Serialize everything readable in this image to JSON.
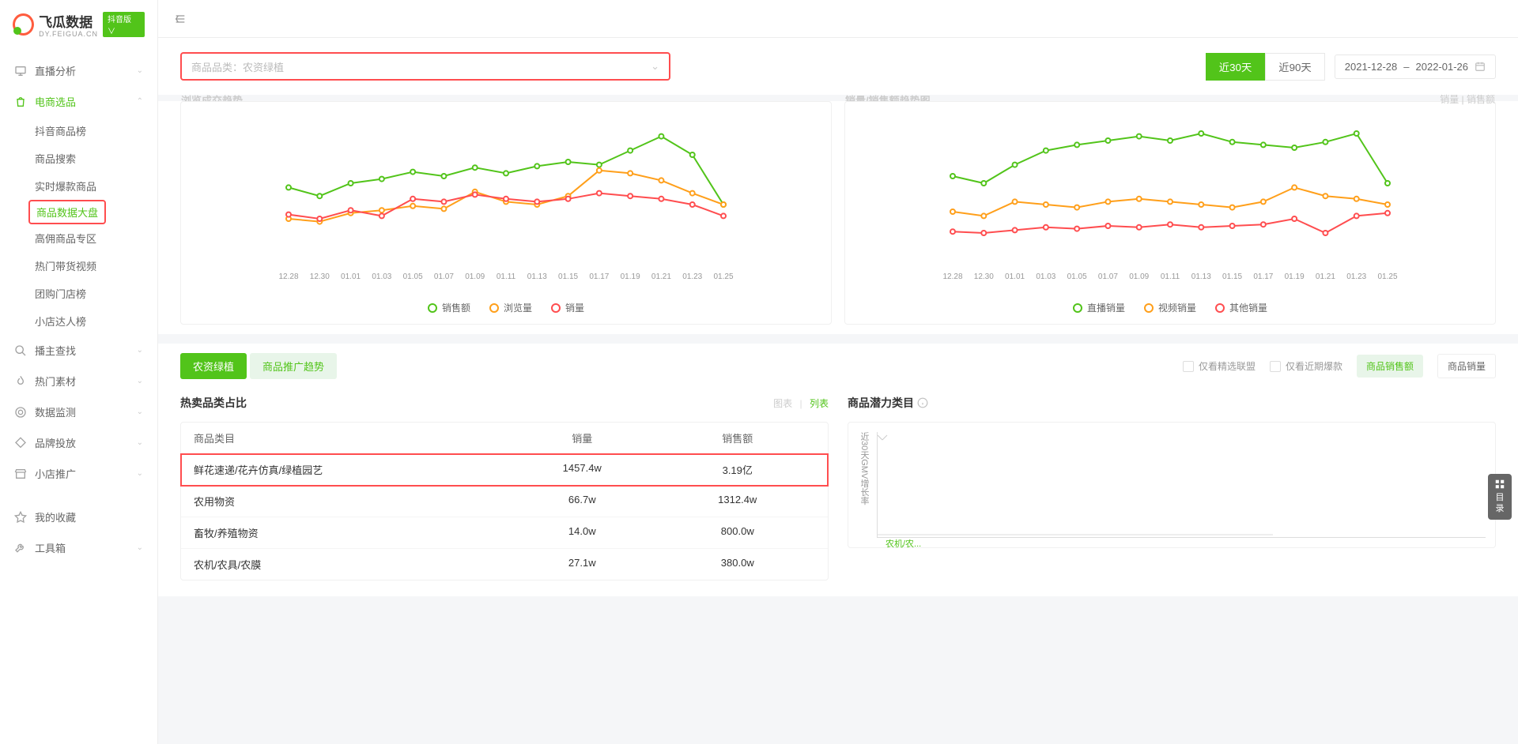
{
  "brand": {
    "name": "飞瓜数据",
    "sub": "DY.FEIGUA.CN",
    "badge": "抖音版 ∨"
  },
  "sidebar": {
    "items": [
      {
        "label": "直播分析",
        "expandable": true
      },
      {
        "label": "电商选品",
        "expandable": true,
        "active": true
      },
      {
        "label": "播主查找",
        "expandable": true
      },
      {
        "label": "热门素材",
        "expandable": true
      },
      {
        "label": "数据监测",
        "expandable": true
      },
      {
        "label": "品牌投放",
        "expandable": true
      },
      {
        "label": "小店推广",
        "expandable": true
      },
      {
        "label": "我的收藏"
      },
      {
        "label": "工具箱",
        "expandable": true
      }
    ],
    "sub": [
      {
        "label": "抖音商品榜"
      },
      {
        "label": "商品搜索"
      },
      {
        "label": "实时爆款商品"
      },
      {
        "label": "商品数据大盘",
        "hl": true
      },
      {
        "label": "高佣商品专区"
      },
      {
        "label": "热门带货视频"
      },
      {
        "label": "团购门店榜"
      },
      {
        "label": "小店达人榜"
      }
    ]
  },
  "filter": {
    "cat_prefix": "商品品类：",
    "cat_value": "农资绿植",
    "d30": "近30天",
    "d90": "近90天",
    "from": "2021-12-28",
    "to": "2022-01-26",
    "sep": "–"
  },
  "chart1_title": "浏览成交趋势",
  "chart2_title": "销量/销售额趋势图",
  "chart2_extra": "销量 | 销售额",
  "legend1": {
    "a": "销售额",
    "b": "浏览量",
    "c": "销量"
  },
  "legend2": {
    "a": "直播销量",
    "b": "视频销量",
    "c": "其他销量"
  },
  "tabs": {
    "a": "农资绿植",
    "b": "商品推广趋势"
  },
  "checks": {
    "a": "仅看精选联盟",
    "b": "仅看近期爆款"
  },
  "metrics": {
    "a": "商品销售额",
    "b": "商品销量"
  },
  "hot": {
    "title": "热卖品类占比",
    "chart": "图表",
    "list": "列表"
  },
  "table": {
    "head": {
      "c1": "商品类目",
      "c2": "销量",
      "c3": "销售额"
    },
    "rows": [
      {
        "c1": "鲜花速递/花卉仿真/绿植园艺",
        "c2": "1457.4w",
        "c3": "3.19亿",
        "hl": true
      },
      {
        "c1": "农用物资",
        "c2": "66.7w",
        "c3": "1312.4w"
      },
      {
        "c1": "畜牧/养殖物资",
        "c2": "14.0w",
        "c3": "800.0w"
      },
      {
        "c1": "农机/农具/农膜",
        "c2": "27.1w",
        "c3": "380.0w"
      }
    ]
  },
  "potential": {
    "title": "商品潜力类目",
    "ylabel": "近30天GMV增长率",
    "point": "农机/农..."
  },
  "float": {
    "a": "目",
    "b": "录"
  },
  "chart_data": [
    {
      "type": "line",
      "title": "浏览成交趋势",
      "x": [
        "12.28",
        "12.30",
        "01.01",
        "01.03",
        "01.05",
        "01.07",
        "01.09",
        "01.11",
        "01.13",
        "01.15",
        "01.17",
        "01.19",
        "01.21",
        "01.23",
        "01.25"
      ],
      "series": [
        {
          "name": "销售额",
          "color": "#52c41a",
          "values": [
            52,
            46,
            55,
            58,
            63,
            60,
            66,
            62,
            67,
            70,
            68,
            78,
            88,
            75,
            40
          ]
        },
        {
          "name": "浏览量",
          "color": "#ff9f1a",
          "values": [
            30,
            28,
            34,
            36,
            39,
            37,
            49,
            42,
            40,
            46,
            64,
            62,
            57,
            48,
            40
          ]
        },
        {
          "name": "销量",
          "color": "#ff4d4f",
          "values": [
            33,
            30,
            36,
            32,
            44,
            42,
            47,
            44,
            42,
            44,
            48,
            46,
            44,
            40,
            32
          ]
        }
      ],
      "ylim": [
        0,
        100
      ]
    },
    {
      "type": "line",
      "title": "销量/销售额趋势图",
      "x": [
        "12.28",
        "12.30",
        "01.01",
        "01.03",
        "01.05",
        "01.07",
        "01.09",
        "01.11",
        "01.13",
        "01.15",
        "01.17",
        "01.19",
        "01.21",
        "01.23",
        "01.25"
      ],
      "series": [
        {
          "name": "直播销量",
          "color": "#52c41a",
          "values": [
            60,
            55,
            68,
            78,
            82,
            85,
            88,
            85,
            90,
            84,
            82,
            80,
            84,
            90,
            55
          ]
        },
        {
          "name": "视频销量",
          "color": "#ff9f1a",
          "values": [
            35,
            32,
            42,
            40,
            38,
            42,
            44,
            42,
            40,
            38,
            42,
            52,
            46,
            44,
            40
          ]
        },
        {
          "name": "其他销量",
          "color": "#ff4d4f",
          "values": [
            21,
            20,
            22,
            24,
            23,
            25,
            24,
            26,
            24,
            25,
            26,
            30,
            20,
            32,
            34
          ]
        }
      ],
      "ylim": [
        0,
        100
      ]
    }
  ]
}
